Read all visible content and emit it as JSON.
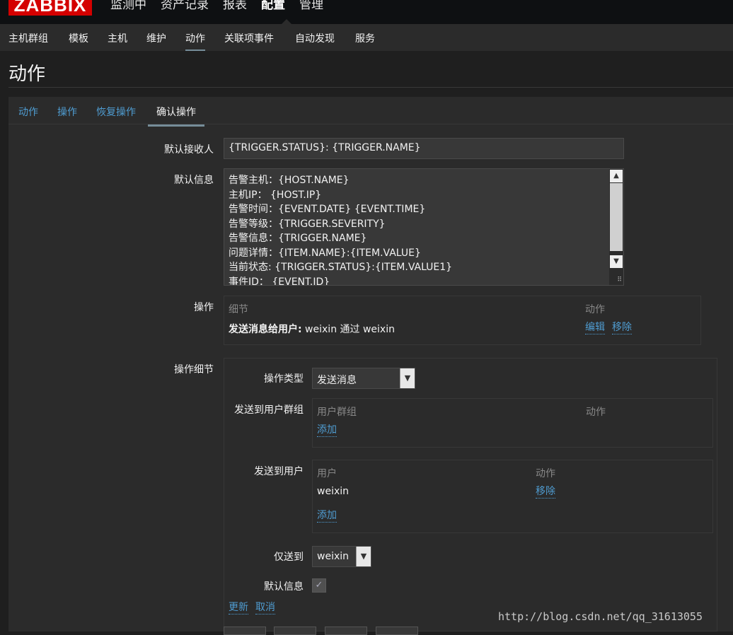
{
  "header": {
    "logo": "ZABBIX",
    "nav": [
      "监测中",
      "资产记录",
      "报表",
      "配置",
      "管理"
    ],
    "active_nav": "配置"
  },
  "subnav": {
    "items": [
      "主机群组",
      "模板",
      "主机",
      "维护",
      "动作",
      "关联项事件",
      "自动发现",
      "服务"
    ],
    "active": "动作"
  },
  "page": {
    "title": "动作"
  },
  "tabs": {
    "items": [
      "动作",
      "操作",
      "恢复操作",
      "确认操作"
    ],
    "active": "确认操作"
  },
  "form": {
    "default_recipient_label": "默认接收人",
    "default_recipient_value": "{TRIGGER.STATUS}: {TRIGGER.NAME}",
    "default_message_label": "默认信息",
    "default_message_lines": [
      "告警主机：{HOST.NAME}",
      "主机IP： {HOST.IP}",
      "告警时间：{EVENT.DATE} {EVENT.TIME}",
      "告警等级：{TRIGGER.SEVERITY}",
      "告警信息：{TRIGGER.NAME}",
      "问题详情：{ITEM.NAME}:{ITEM.VALUE}",
      "当前状态: {TRIGGER.STATUS}:{ITEM.VALUE1}",
      "事件ID： {EVENT.ID}"
    ],
    "operations_label": "操作",
    "operations_table": {
      "col_details": "细节",
      "col_action": "动作",
      "row_bold": "发送消息给用户:",
      "row_text": " weixin 通过 weixin",
      "edit": "编辑",
      "remove": "移除"
    },
    "operation_details_label": "操作细节",
    "details": {
      "operation_type_label": "操作类型",
      "operation_type_value": "发送消息",
      "send_to_groups_label": "发送到用户群组",
      "groups_col_group": "用户群组",
      "groups_col_action": "动作",
      "groups_add": "添加",
      "send_to_users_label": "发送到用户",
      "users_col_user": "用户",
      "users_col_action": "动作",
      "user_name": "weixin",
      "user_remove": "移除",
      "users_add": "添加",
      "send_only_to_label": "仅送到",
      "send_only_to_value": "weixin",
      "default_message_label": "默认信息",
      "default_message_checked": true,
      "update": "更新",
      "cancel": "取消"
    }
  },
  "watermark": "http://blog.csdn.net/qq_31613055"
}
